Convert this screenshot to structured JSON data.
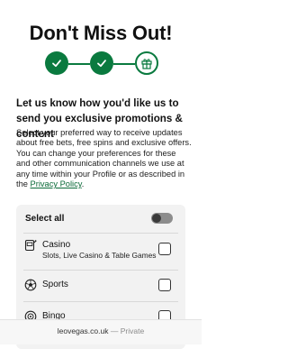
{
  "title": "Don't Miss Out!",
  "stepper": {
    "steps": [
      {
        "state": "completed",
        "icon": "check-icon"
      },
      {
        "state": "completed",
        "icon": "check-icon"
      },
      {
        "state": "current",
        "icon": "gift-icon"
      }
    ],
    "accent_color": "#0a7a3f"
  },
  "heading": "Let us know how you'd like us to send you exclusive promotions & content",
  "body": {
    "text": "Select your preferred way to receive updates about free bets, free spins and exclusive offers. You can change your preferences for these and other communication channels we use at any time within your Profile or as described in the ",
    "link": "Privacy Policy",
    "suffix": "."
  },
  "preferences": {
    "select_all": {
      "label": "Select all",
      "on": false
    },
    "items": [
      {
        "label": "Casino",
        "sublabel": "Slots, Live Casino & Table Games",
        "icon": "casino-icon",
        "checked": false
      },
      {
        "label": "Sports",
        "sublabel": "",
        "icon": "football-icon",
        "checked": false
      },
      {
        "label": "Bingo",
        "sublabel": "",
        "icon": "bingo-icon",
        "checked": false
      }
    ]
  },
  "browser": {
    "domain": "leovegas.co.uk",
    "separator": "—",
    "mode": "Private"
  }
}
